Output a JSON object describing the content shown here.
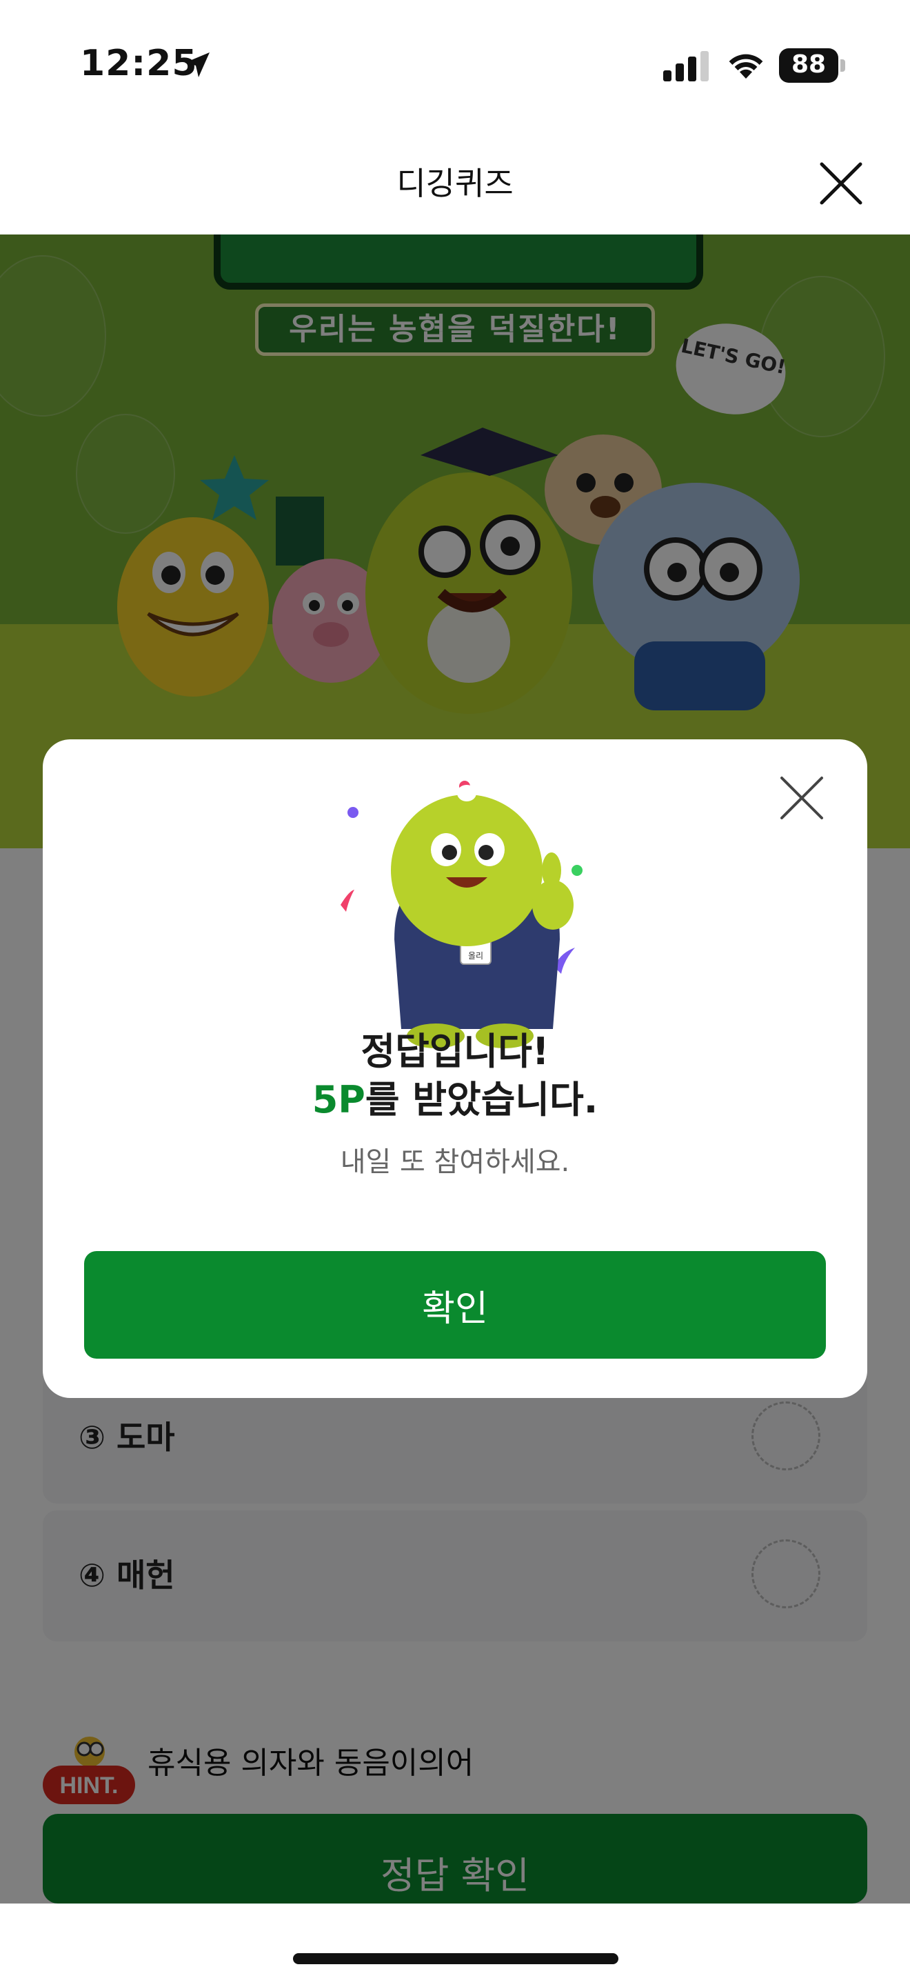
{
  "status_bar": {
    "time": "12:25",
    "battery": "88"
  },
  "nav": {
    "title": "디깅퀴즈"
  },
  "banner": {
    "subtitle": "우리는 농협을 덕질한다!",
    "bubble_text": "LET'S GO!"
  },
  "modal": {
    "title": "정답입니다!",
    "reward_points": "5P",
    "reward_suffix": "를 받았습니다.",
    "subtitle": "내일 또 참여하세요.",
    "confirm_label": "확인",
    "mascot_badge": "올리"
  },
  "quiz": {
    "options": [
      {
        "label": "③ 도마"
      },
      {
        "label": "④ 매헌"
      }
    ],
    "hint_badge": "HINT.",
    "hint_text": "휴식용 의자와 동음이의어",
    "check_button": "정답 확인"
  },
  "colors": {
    "primary_green": "#0a8a2e",
    "banner_green": "#78b036"
  }
}
